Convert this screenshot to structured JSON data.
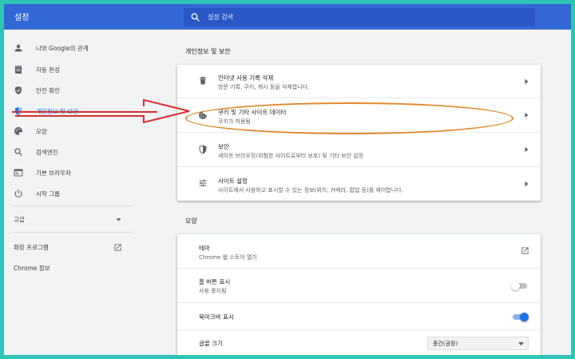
{
  "header": {
    "title": "설정",
    "search_placeholder": "설정 검색"
  },
  "sidebar": {
    "items": [
      {
        "label": "나와 Google의 관계",
        "icon": "person-icon"
      },
      {
        "label": "자동 완성",
        "icon": "clipboard-icon"
      },
      {
        "label": "안전 확인",
        "icon": "shield-check-icon"
      },
      {
        "label": "개인정보 및 보안",
        "icon": "shield-icon",
        "active": true
      },
      {
        "label": "모양",
        "icon": "palette-icon"
      },
      {
        "label": "검색엔진",
        "icon": "search-icon"
      },
      {
        "label": "기본 브라우저",
        "icon": "browser-icon"
      },
      {
        "label": "시작 그룹",
        "icon": "power-icon"
      }
    ],
    "advanced_label": "고급",
    "extensions_label": "확장 프로그램",
    "about_label": "Chrome 정보"
  },
  "privacy": {
    "section_title": "개인정보 및 보안",
    "rows": [
      {
        "title": "인터넷 사용 기록 삭제",
        "subtitle": "방문 기록, 쿠키, 캐시 등을 삭제합니다.",
        "icon": "trash-icon"
      },
      {
        "title": "쿠키 및 기타 사이트 데이터",
        "subtitle": "쿠키가 허용됨",
        "icon": "cookie-icon"
      },
      {
        "title": "보안",
        "subtitle": "세이프 브라우징(위험한 사이트로부터 보호) 및 기타 보안 설정",
        "icon": "shield-icon"
      },
      {
        "title": "사이트 설정",
        "subtitle": "사이트에서 사용하고 표시할 수 있는 정보(위치, 카메라, 팝업 등)를 제어합니다.",
        "icon": "tune-icon"
      }
    ]
  },
  "appearance": {
    "section_title": "모양",
    "theme_title": "테마",
    "theme_subtitle": "Chrome 웹 스토어 열기",
    "home_title": "홈 버튼 표시",
    "home_subtitle": "사용 중지됨",
    "home_toggle_on": false,
    "bookmarks_title": "북마크바 표시",
    "bookmarks_toggle_on": true,
    "font_size_title": "글꼴 크기",
    "font_size_value": "중간(권장)"
  },
  "colors": {
    "header_bg": "#3367d6",
    "accent": "#1a73e8",
    "highlight_oval": "#e08a2b",
    "arrow": "#d32f2f",
    "frame_border": "#2ec4b6"
  }
}
